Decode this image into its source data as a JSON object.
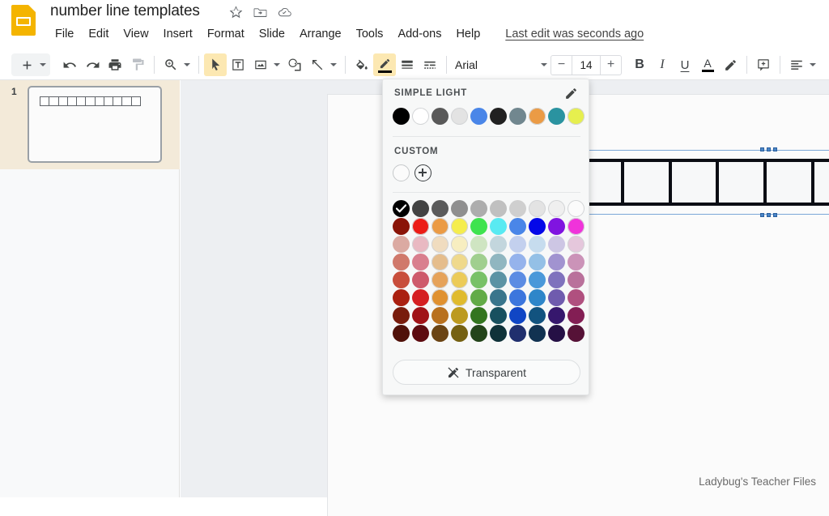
{
  "app": {
    "logo_icon": "slides-logo-icon",
    "doc_title": "number line templates",
    "title_icons": [
      {
        "name": "star-icon",
        "label": "Star"
      },
      {
        "name": "move-to-folder-icon",
        "label": "Move to folder"
      },
      {
        "name": "cloud-saved-icon",
        "label": "Saved to Drive"
      }
    ]
  },
  "menubar": {
    "items": [
      {
        "label": "File"
      },
      {
        "label": "Edit"
      },
      {
        "label": "View"
      },
      {
        "label": "Insert"
      },
      {
        "label": "Format"
      },
      {
        "label": "Slide"
      },
      {
        "label": "Arrange"
      },
      {
        "label": "Tools"
      },
      {
        "label": "Add-ons"
      },
      {
        "label": "Help"
      }
    ],
    "last_edit": "Last edit was seconds ago"
  },
  "toolbar": {
    "add_slide_label": "+",
    "items": [
      {
        "name": "undo-icon",
        "label": "Undo"
      },
      {
        "name": "redo-icon",
        "label": "Redo"
      },
      {
        "name": "print-icon",
        "label": "Print"
      },
      {
        "name": "paint-format-icon",
        "label": "Paint format"
      },
      {
        "name": "zoom-icon",
        "label": "Zoom"
      },
      {
        "name": "select-icon",
        "label": "Select"
      },
      {
        "name": "textbox-icon",
        "label": "Text box"
      },
      {
        "name": "image-icon",
        "label": "Insert image"
      },
      {
        "name": "shape-icon",
        "label": "Shape"
      },
      {
        "name": "line-icon",
        "label": "Line"
      },
      {
        "name": "fill-color-icon",
        "label": "Fill color"
      },
      {
        "name": "border-color-icon",
        "label": "Border color"
      },
      {
        "name": "border-weight-icon",
        "label": "Border weight"
      },
      {
        "name": "border-dash-icon",
        "label": "Border dash"
      }
    ],
    "font_family": "Arial",
    "font_size": "14",
    "font_size_decrease": "−",
    "font_size_increase": "+",
    "bold_label": "B",
    "italic_label": "I",
    "underline_label": "U",
    "text_color_label": "A",
    "highlight_icon": "highlight-pen-icon",
    "comment_icon": "add-comment-icon",
    "align_icon": "align-icon"
  },
  "filmstrip": {
    "slides": [
      {
        "number": "1",
        "segments": 11
      }
    ]
  },
  "canvas": {
    "shape": {
      "name": "number-line-shape",
      "segments": 10
    },
    "watermark": "Ladybug's Teacher Files"
  },
  "color_picker": {
    "theme_section_label": "SIMPLE LIGHT",
    "theme_edit_icon": "edit-pencil-icon",
    "theme_colors": [
      "#000000",
      "#ffffff",
      "#595959",
      "#e3e3e3",
      "#4a86e8",
      "#212121",
      "#71878f",
      "#eb9b45",
      "#2a93a0",
      "#e6ef4e"
    ],
    "custom_section_label": "CUSTOM",
    "custom_colors": [],
    "custom_add_icon": "add-custom-color-icon",
    "selected_color": "#000000",
    "palette": [
      [
        "#000000",
        "#434343",
        "#5b5b5b",
        "#8f8f8f",
        "#adadad",
        "#c0c0c0",
        "#cfcfcf",
        "#e3e3e3",
        "#efefef",
        "#fbfbfb"
      ],
      [
        "#8a1408",
        "#ec1c16",
        "#eb9b45",
        "#f5ed4d",
        "#3fe34f",
        "#59eaf2",
        "#4a86e8",
        "#0408e8",
        "#8014e0",
        "#f033da"
      ],
      [
        "#dbaaa2",
        "#e9b9c2",
        "#f0dcbf",
        "#f7eec0",
        "#cfe5c2",
        "#c3d6dd",
        "#c3d0ee",
        "#c6dcee",
        "#cdc6e4",
        "#e5c7dc"
      ],
      [
        "#d0796b",
        "#d97f8e",
        "#e5bd8c",
        "#efd98c",
        "#a0cf8f",
        "#90b6c0",
        "#95b3ec",
        "#94c0e6",
        "#a193d0",
        "#cb93b8"
      ],
      [
        "#c84e3b",
        "#ce5a6b",
        "#e6a35a",
        "#eccb58",
        "#78c167",
        "#5c93a4",
        "#5b8ce3",
        "#4a98d9",
        "#7f72bd",
        "#b9719b"
      ],
      [
        "#aa2010",
        "#d51f22",
        "#e0912f",
        "#e0bb2d",
        "#62ab47",
        "#39758c",
        "#3c76dd",
        "#2e86c9",
        "#6f5bae",
        "#b0507f"
      ],
      [
        "#781c0c",
        "#a01217",
        "#b8711f",
        "#bc9a1f",
        "#33751f",
        "#18505f",
        "#1046c5",
        "#12537f",
        "#36176d",
        "#831e54"
      ],
      [
        "#501109",
        "#5d0b10",
        "#6b4414",
        "#756112",
        "#23441a",
        "#0f3239",
        "#202f6e",
        "#113251",
        "#251045",
        "#561237"
      ]
    ],
    "transparent_label": "Transparent",
    "transparent_icon": "no-border-icon"
  }
}
